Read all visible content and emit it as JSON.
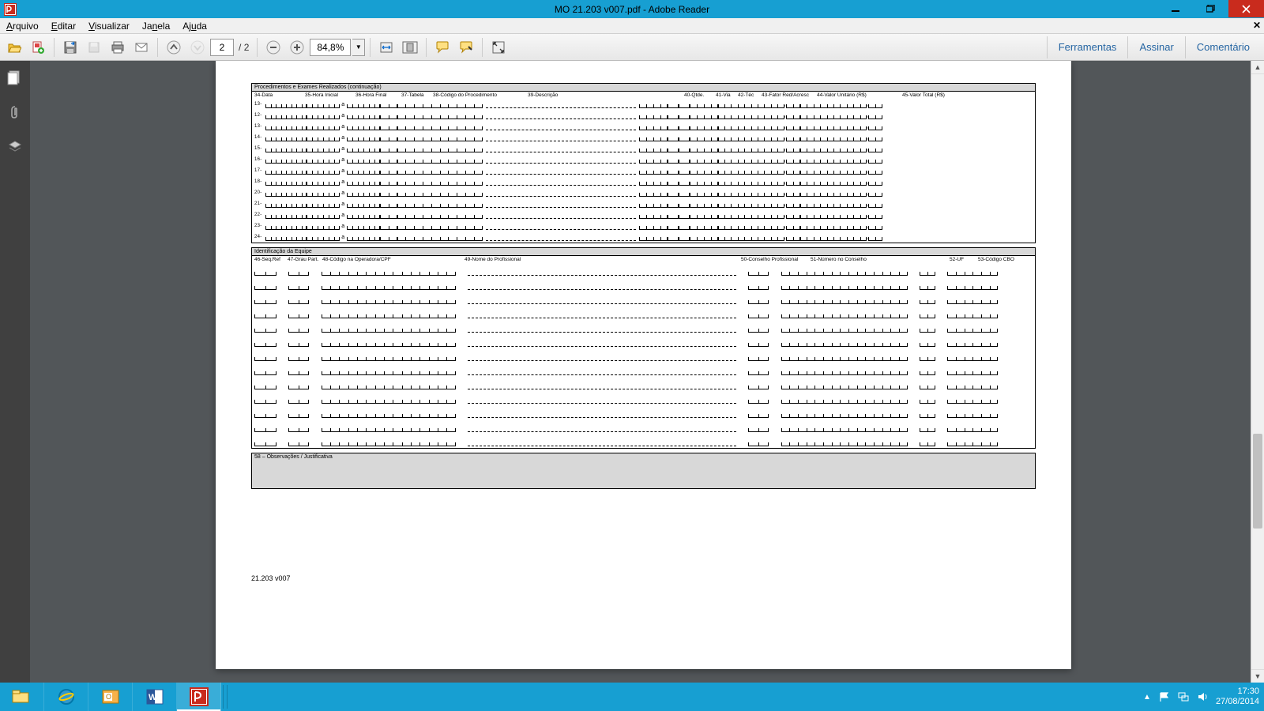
{
  "window": {
    "title": "MO 21.203 v007.pdf - Adobe Reader"
  },
  "menu": {
    "arquivo": "Arquivo",
    "editar": "Editar",
    "visualizar": "Visualizar",
    "janela": "Janela",
    "ajuda": "Ajuda"
  },
  "toolbar": {
    "page_current": "2",
    "page_sep": "/",
    "page_total": "2",
    "zoom": "84,8%",
    "ferramentas": "Ferramentas",
    "assinar": "Assinar",
    "comentario": "Comentário"
  },
  "form": {
    "section1_title": "Procedimentos e Exames Realizados (continuação)",
    "s1_cols": {
      "c34": "34-Data",
      "c35": "35-Hora Inicial",
      "c36": "36-Hora Final",
      "c37": "37-Tabela",
      "c38": "38-Código do Procedimento",
      "c39": "39-Descrição",
      "c40": "40-Qtde.",
      "c41": "41-Via",
      "c42": "42-Téc",
      "c43": "43-Fator Red/Acresc",
      "c44": "44-Valor Unitário (R$)",
      "c45": "45-Valor Total  (R$)"
    },
    "s1_rownums": [
      "13-",
      "12-",
      "13-",
      "14-",
      "15-",
      "16-",
      "17-",
      "18-",
      "20-",
      "21-",
      "22-",
      "23-",
      "24-"
    ],
    "section2_title": "Identificação da Equipe",
    "s2_cols": {
      "c46": "46-Seq.Ref",
      "c47": "47-Grau Part.",
      "c48": "48-Código na Operadora/CPF",
      "c49": "49-Nome do Profissional",
      "c50": "50-Conselho Profissional",
      "c51": "51-Número no Conselho",
      "c52": "52-UF",
      "c53": "53-Código CBO"
    },
    "section3_title": "58 – Observações / Justificativa",
    "footer": "21.203 v007"
  },
  "tray": {
    "time": "17:30",
    "date": "27/08/2014"
  }
}
